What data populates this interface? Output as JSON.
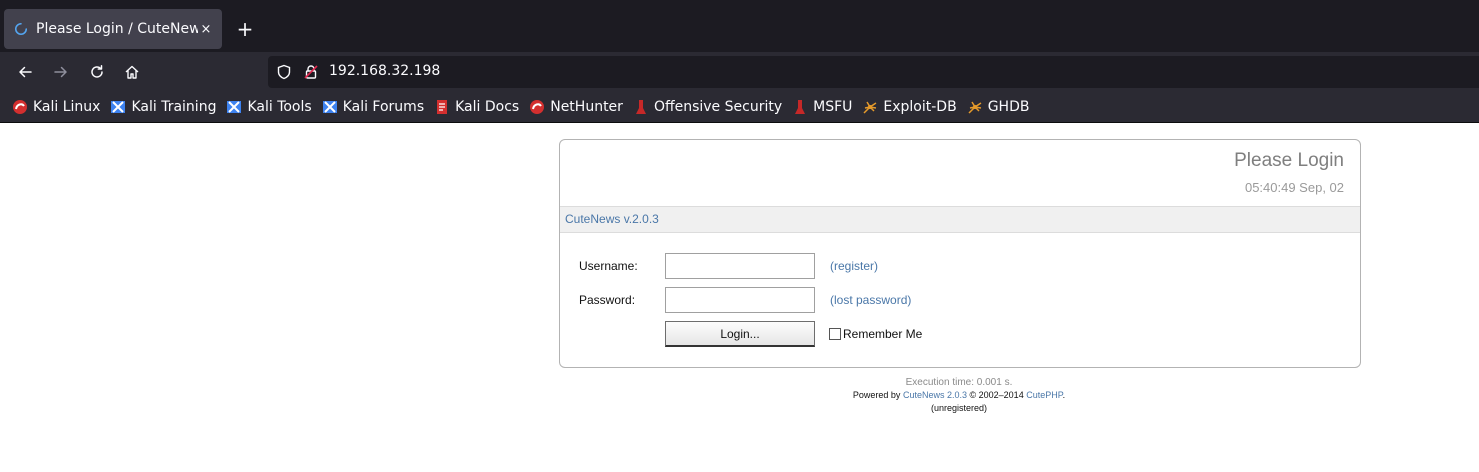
{
  "browser": {
    "tab": {
      "title": "Please Login / CuteNews",
      "close": "×"
    },
    "new_tab": "+",
    "url": "192.168.32.198",
    "bookmarks": [
      {
        "label": "Kali Linux",
        "icon": "kali-dragon-icon"
      },
      {
        "label": "Kali Training",
        "icon": "kali-training-icon"
      },
      {
        "label": "Kali Tools",
        "icon": "kali-tools-icon"
      },
      {
        "label": "Kali Forums",
        "icon": "kali-forums-icon"
      },
      {
        "label": "Kali Docs",
        "icon": "kali-docs-icon"
      },
      {
        "label": "NetHunter",
        "icon": "nethunter-icon"
      },
      {
        "label": "Offensive Security",
        "icon": "offsec-icon"
      },
      {
        "label": "MSFU",
        "icon": "msfu-icon"
      },
      {
        "label": "Exploit-DB",
        "icon": "exploit-db-icon"
      },
      {
        "label": "GHDB",
        "icon": "ghdb-icon"
      }
    ]
  },
  "login": {
    "title": "Please Login",
    "time": "05:40:49 Sep, 02",
    "version": "CuteNews v.2.0.3",
    "username_label": "Username:",
    "password_label": "Password:",
    "username_value": "",
    "password_value": "",
    "register_link": "(register)",
    "lost_password_link": "(lost password)",
    "login_button": "Login...",
    "remember_label": "Remember Me"
  },
  "footer": {
    "exec_time": "Execution time: 0.001 s.",
    "powered_by": "Powered by",
    "product_link": "CuteNews 2.0.3",
    "copyright": "© 2002–2014",
    "vendor_link": "CutePHP",
    "period": ".",
    "license": "(unregistered)"
  },
  "colors": {
    "tabbar_bg": "#1c1b22",
    "toolbar_bg": "#2b2a33",
    "link": "#4a77a8",
    "title_gray": "#7f7f7f"
  }
}
